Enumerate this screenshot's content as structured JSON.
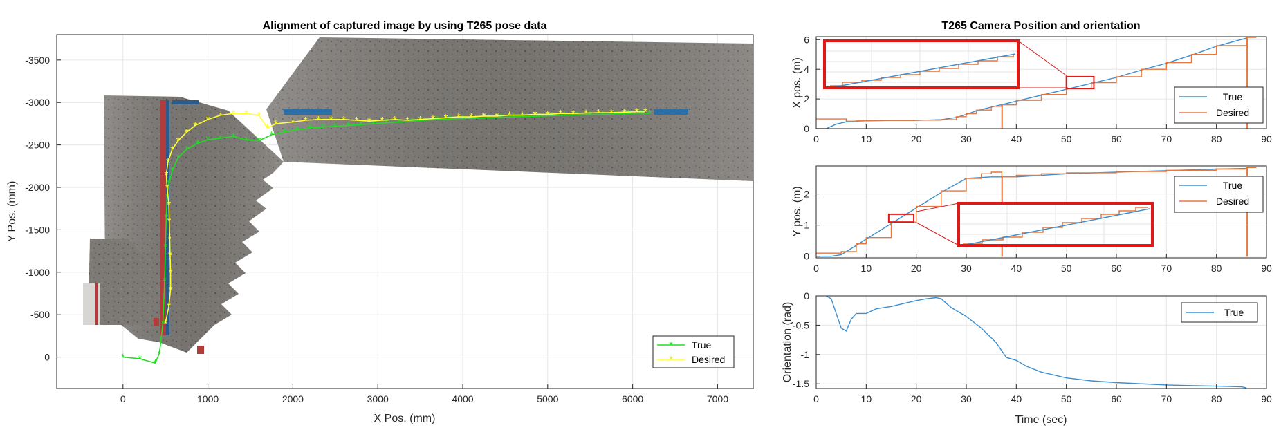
{
  "colors": {
    "true_left": "#22dd22",
    "desired_left": "#ffff33",
    "true_right": "#3b8fd0",
    "desired_right": "#e8773c",
    "zoom_box": "#e01818",
    "grid": "#e6e6e6",
    "axis": "#262626"
  },
  "chart_data": [
    {
      "type": "line",
      "title": "Alignment of captured image by using T265 pose data",
      "xlabel": "X Pos. (mm)",
      "ylabel": "Y Pos. (mm)",
      "xlim": [
        -780,
        7420
      ],
      "ylim": [
        -3800,
        370
      ],
      "y_reversed": true,
      "grid": true,
      "legend_position": "bottom-right",
      "background_image": "stitched-photo-mosaic",
      "xticks": [
        0,
        1000,
        2000,
        3000,
        4000,
        5000,
        6000,
        7000
      ],
      "yticks": [
        -3500,
        -3000,
        -2500,
        -2000,
        -1500,
        -1000,
        -500,
        0
      ],
      "series": [
        {
          "name": "True",
          "marker": "star",
          "x": [
            0,
            200,
            380,
            430,
            470,
            490,
            500,
            510,
            520,
            540,
            580,
            650,
            750,
            880,
            1000,
            1150,
            1300,
            1450,
            1600,
            1750,
            1900,
            2050,
            2200,
            2350,
            2500,
            2650,
            2800,
            2950,
            3100,
            3250,
            3400,
            3550,
            3700,
            3850,
            4000,
            4150,
            4300,
            4450,
            4600,
            4750,
            4900,
            5050,
            5200,
            5350,
            5500,
            5650,
            5800,
            5950,
            6100,
            6200
          ],
          "y": [
            0,
            20,
            70,
            -50,
            -400,
            -900,
            -1300,
            -1650,
            -1900,
            -2050,
            -2200,
            -2350,
            -2450,
            -2520,
            -2560,
            -2580,
            -2600,
            -2560,
            -2550,
            -2620,
            -2650,
            -2680,
            -2700,
            -2710,
            -2720,
            -2730,
            -2740,
            -2750,
            -2760,
            -2770,
            -2780,
            -2790,
            -2800,
            -2805,
            -2810,
            -2815,
            -2820,
            -2825,
            -2830,
            -2835,
            -2840,
            -2845,
            -2850,
            -2855,
            -2860,
            -2860,
            -2865,
            -2870,
            -2875,
            -2870
          ]
        },
        {
          "name": "Desired",
          "marker": "star",
          "x": [
            500,
            540,
            560,
            560,
            555,
            550,
            545,
            540,
            520,
            510,
            530,
            580,
            650,
            750,
            850,
            1000,
            1150,
            1300,
            1450,
            1600,
            1700,
            1800,
            2000,
            2150,
            2300,
            2450,
            2600,
            2750,
            2900,
            3050,
            3200,
            3350,
            3500,
            3650,
            3800,
            3950,
            4100,
            4250,
            4400,
            4550,
            4700,
            4850,
            5000,
            5150,
            5300,
            5450,
            5600,
            5750,
            5900,
            6050,
            6150
          ],
          "y": [
            -400,
            -600,
            -800,
            -1000,
            -1200,
            -1400,
            -1600,
            -1800,
            -2000,
            -2150,
            -2300,
            -2450,
            -2550,
            -2650,
            -2730,
            -2800,
            -2850,
            -2870,
            -2870,
            -2850,
            -2700,
            -2750,
            -2770,
            -2790,
            -2800,
            -2800,
            -2800,
            -2790,
            -2780,
            -2790,
            -2800,
            -2790,
            -2800,
            -2810,
            -2820,
            -2830,
            -2830,
            -2840,
            -2840,
            -2850,
            -2850,
            -2860,
            -2860,
            -2870,
            -2870,
            -2875,
            -2880,
            -2880,
            -2885,
            -2890,
            -2890
          ]
        }
      ]
    },
    {
      "type": "line",
      "title": "T265 Camera Position and orientation",
      "xlabel": "",
      "ylabel": "X pos. (m)",
      "xlim": [
        0,
        90
      ],
      "ylim": [
        0,
        6.2
      ],
      "grid": true,
      "legend_position": "right",
      "xticks": [
        0,
        10,
        20,
        30,
        40,
        50,
        60,
        70,
        80,
        90
      ],
      "yticks": [
        0,
        2,
        4,
        6
      ],
      "zoom_region": {
        "x": [
          50,
          55.5
        ],
        "y": [
          2.7,
          3.5
        ]
      },
      "series": [
        {
          "name": "True",
          "x": [
            0,
            2,
            4,
            6,
            8,
            10,
            15,
            20,
            25,
            28,
            30,
            32,
            35,
            40,
            45,
            50,
            55,
            60,
            65,
            70,
            75,
            80,
            86
          ],
          "y": [
            0,
            0,
            0.3,
            0.45,
            0.5,
            0.52,
            0.55,
            0.55,
            0.6,
            0.75,
            0.95,
            1.2,
            1.45,
            1.85,
            2.25,
            2.65,
            3.05,
            3.45,
            3.95,
            4.4,
            4.95,
            5.55,
            6.1
          ]
        },
        {
          "name": "Desired",
          "x": [
            0,
            4,
            6,
            8,
            10,
            15,
            20,
            25,
            28,
            30,
            32,
            35,
            37,
            37.1,
            37.2,
            40,
            45,
            50,
            55,
            60,
            65,
            70,
            75,
            80,
            86,
            86.1,
            86.2,
            88
          ],
          "y": [
            0.65,
            0.65,
            0.5,
            0.52,
            0.55,
            0.55,
            0.57,
            0.6,
            0.8,
            1.0,
            1.25,
            1.5,
            1.6,
            0,
            1.6,
            1.9,
            2.3,
            2.7,
            3.1,
            3.5,
            4.0,
            4.45,
            5.0,
            5.6,
            6.15,
            0,
            6.15,
            6.15
          ]
        }
      ]
    },
    {
      "type": "line",
      "title": "",
      "xlabel": "",
      "ylabel": "Y pos. (m)",
      "xlim": [
        0,
        90
      ],
      "ylim": [
        -0.05,
        2.9
      ],
      "grid": true,
      "legend_position": "right",
      "xticks": [
        0,
        10,
        20,
        30,
        40,
        50,
        60,
        70,
        80,
        90
      ],
      "yticks": [
        0,
        1,
        2
      ],
      "zoom_region": {
        "x": [
          14.5,
          19.5
        ],
        "y": [
          1.1,
          1.35
        ]
      },
      "series": [
        {
          "name": "True",
          "x": [
            0,
            3,
            5,
            8,
            10,
            15,
            20,
            25,
            30,
            35,
            38,
            40,
            45,
            50,
            60,
            70,
            80,
            86
          ],
          "y": [
            0,
            0,
            0.05,
            0.35,
            0.55,
            1.05,
            1.55,
            2.05,
            2.5,
            2.55,
            2.55,
            2.55,
            2.6,
            2.65,
            2.7,
            2.75,
            2.8,
            2.82
          ]
        },
        {
          "name": "Desired",
          "x": [
            0,
            4,
            5,
            8,
            10,
            15,
            20,
            25,
            30,
            33,
            35,
            37,
            37.1,
            37.2,
            40,
            45,
            50,
            60,
            70,
            80,
            86,
            86.1,
            86.2,
            88
          ],
          "y": [
            0.1,
            0.1,
            0.15,
            0.4,
            0.6,
            1.1,
            1.6,
            2.1,
            2.5,
            2.65,
            2.7,
            2.7,
            0,
            2.55,
            2.6,
            2.65,
            2.68,
            2.72,
            2.76,
            2.8,
            2.85,
            0,
            2.85,
            2.85
          ]
        }
      ]
    },
    {
      "type": "line",
      "title": "",
      "xlabel": "Time (sec)",
      "ylabel": "Orientation (rad)",
      "xlim": [
        0,
        90
      ],
      "ylim": [
        -1.58,
        0
      ],
      "grid": true,
      "legend_position": "top-right",
      "xticks": [
        0,
        10,
        20,
        30,
        40,
        50,
        60,
        70,
        80,
        90
      ],
      "yticks": [
        0,
        -0.5,
        -1,
        -1.5
      ],
      "ytick_labels": [
        "0",
        "-0.5",
        "-1",
        "-1.5"
      ],
      "series": [
        {
          "name": "True",
          "x": [
            2,
            3,
            5,
            6,
            7,
            8,
            9,
            10,
            12,
            15,
            18,
            20,
            22,
            24,
            25,
            27,
            30,
            33,
            36,
            38,
            40,
            42,
            45,
            50,
            55,
            60,
            65,
            70,
            75,
            80,
            85,
            86
          ],
          "y": [
            0,
            -0.05,
            -0.55,
            -0.6,
            -0.4,
            -0.3,
            -0.3,
            -0.3,
            -0.22,
            -0.18,
            -0.12,
            -0.08,
            -0.05,
            -0.03,
            -0.05,
            -0.2,
            -0.35,
            -0.55,
            -0.8,
            -1.05,
            -1.1,
            -1.2,
            -1.3,
            -1.4,
            -1.45,
            -1.48,
            -1.5,
            -1.52,
            -1.53,
            -1.54,
            -1.55,
            -1.57
          ]
        }
      ]
    }
  ]
}
